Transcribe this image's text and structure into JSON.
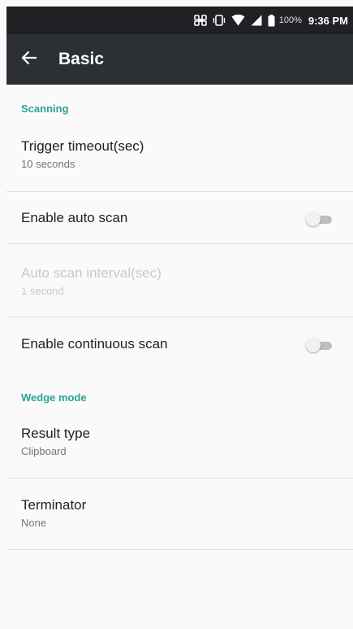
{
  "status_bar": {
    "battery_percent": "100%",
    "time": "9:36 PM",
    "icons": [
      "nfc-icon",
      "vibrate-icon",
      "wifi-icon",
      "signal-icon",
      "battery-icon"
    ]
  },
  "app_bar": {
    "back_icon": "arrow-left-icon",
    "title": "Basic"
  },
  "sections": {
    "scanning": {
      "title": "Scanning",
      "trigger_timeout": {
        "title": "Trigger timeout(sec)",
        "summary": "10 seconds"
      },
      "auto_scan": {
        "title": "Enable auto scan",
        "enabled": false
      },
      "auto_scan_interval": {
        "title": "Auto scan interval(sec)",
        "summary": "1 second",
        "disabled": true
      },
      "continuous_scan": {
        "title": "Enable continuous scan",
        "enabled": false
      }
    },
    "wedge_mode": {
      "title": "Wedge mode",
      "result_type": {
        "title": "Result type",
        "summary": "Clipboard"
      },
      "terminator": {
        "title": "Terminator",
        "summary": "None"
      }
    }
  },
  "colors": {
    "accent": "#2aa399",
    "app_bar": "#2c2f33",
    "status_bar": "#1f2124",
    "background": "#fafafa"
  }
}
